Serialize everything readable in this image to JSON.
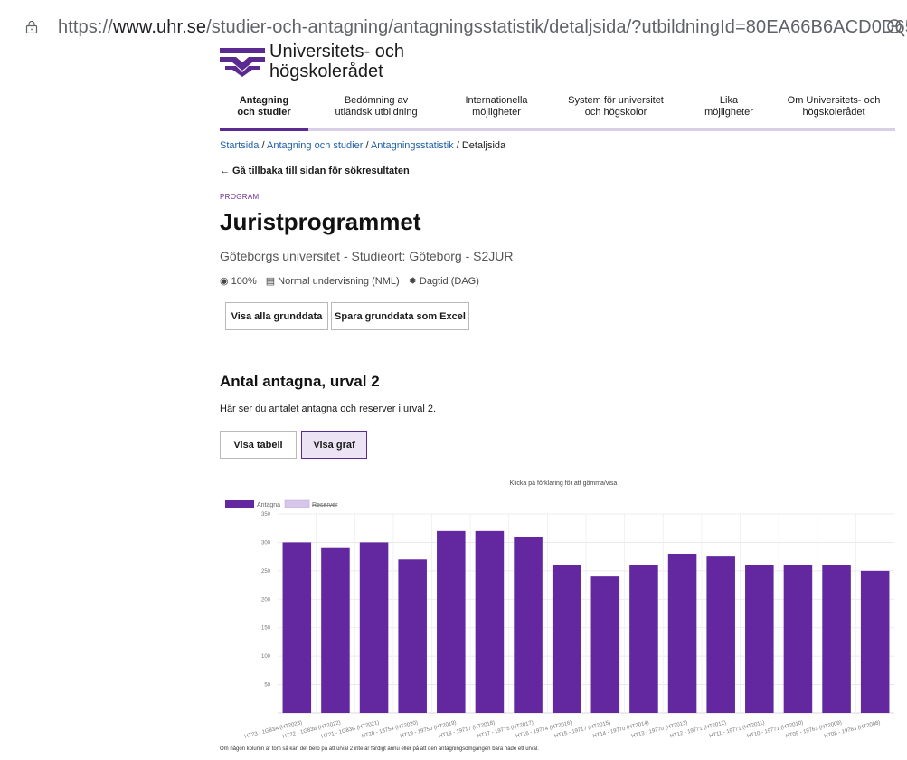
{
  "browser": {
    "url_prefix": "https://",
    "url_host": "www.uhr.se",
    "url_path": "/studier-och-antagning/antagningsstatistik/detaljsida/?utbildningId=80EA66B6ACD0D656..."
  },
  "logo": {
    "line1": "Universitets- och",
    "line2": "högskolerådet"
  },
  "nav": [
    {
      "line1": "Antagning",
      "line2": "och studier"
    },
    {
      "line1": "Bedömning av",
      "line2": "utländsk utbildning"
    },
    {
      "line1": "Internationella",
      "line2": "möjligheter"
    },
    {
      "line1": "System för universitet",
      "line2": "och högskolor"
    },
    {
      "line1": "Lika",
      "line2": "möjligheter"
    },
    {
      "line1": "Om Universitets- och",
      "line2": "högskolerådet"
    }
  ],
  "breadcrumb": {
    "home": "Startsida",
    "sep": " / ",
    "level1": "Antagning och studier",
    "level2": "Antagningsstatistik",
    "current": "Detaljsida"
  },
  "back_link": "← Gå tillbaka till sidan för sökresultaten",
  "kicker": "PROGRAM",
  "title": "Juristprogrammet",
  "subtitle": "Göteborgs universitet - Studieort: Göteborg - S2JUR",
  "meta": {
    "pace": "100%",
    "form": "Normal undervisning (NML)",
    "time": "Dagtid (DAG)"
  },
  "buttons": {
    "show_all": "Visa alla grunddata",
    "save_excel": "Spara grunddata som Excel",
    "show_table": "Visa tabell",
    "show_graph": "Visa graf"
  },
  "section": {
    "title": "Antal antagna, urval 2",
    "desc": "Här ser du antalet antagna och reserver i urval 2."
  },
  "footnote": "Om någon kolumn är tom så kan det bero på att urval 2 inte är färdigt ännu eller på att den antagningsomgången bara hade ett urval.",
  "colors": {
    "accent": "#5b2a91",
    "bar": "#6328a0",
    "reserve": "#d5c6ea"
  },
  "chart_data": {
    "type": "bar",
    "title": "Klicka på förklaring för att gömma/visa",
    "legend": [
      "Antagna",
      "Reserver"
    ],
    "legend_placement": "top-left",
    "ylim": [
      0,
      350
    ],
    "yticks": [
      50,
      100,
      150,
      200,
      250,
      300,
      350
    ],
    "grid": true,
    "categories": [
      "HT23 - 1G83A (HT2023)",
      "HT22 - 1G83B (HT2022)",
      "HT21 - 1G83B (HT2021)",
      "HT20 - 18754 (HT2020)",
      "HT19 - 19750 (HT2019)",
      "HT18 - 19717 (HT2018)",
      "HT17 - 19775 (HT2017)",
      "HT16 - 19774 (HT2016)",
      "HT15 - 19717 (HT2015)",
      "HT14 - 19770 (HT2014)",
      "HT13 - 19770 (HT2013)",
      "HT12 - 19771 (HT2012)",
      "HT11 - 19771 (HT2011)",
      "HT10 - 19771 (HT2010)",
      "HT09 - 19763 (HT2009)",
      "HT08 - 19763 (HT2008)"
    ],
    "series": [
      {
        "name": "Antagna",
        "values": [
          300,
          290,
          300,
          270,
          320,
          320,
          310,
          260,
          240,
          260,
          280,
          275,
          260,
          260,
          260,
          250
        ]
      },
      {
        "name": "Reserver",
        "values": []
      }
    ]
  }
}
